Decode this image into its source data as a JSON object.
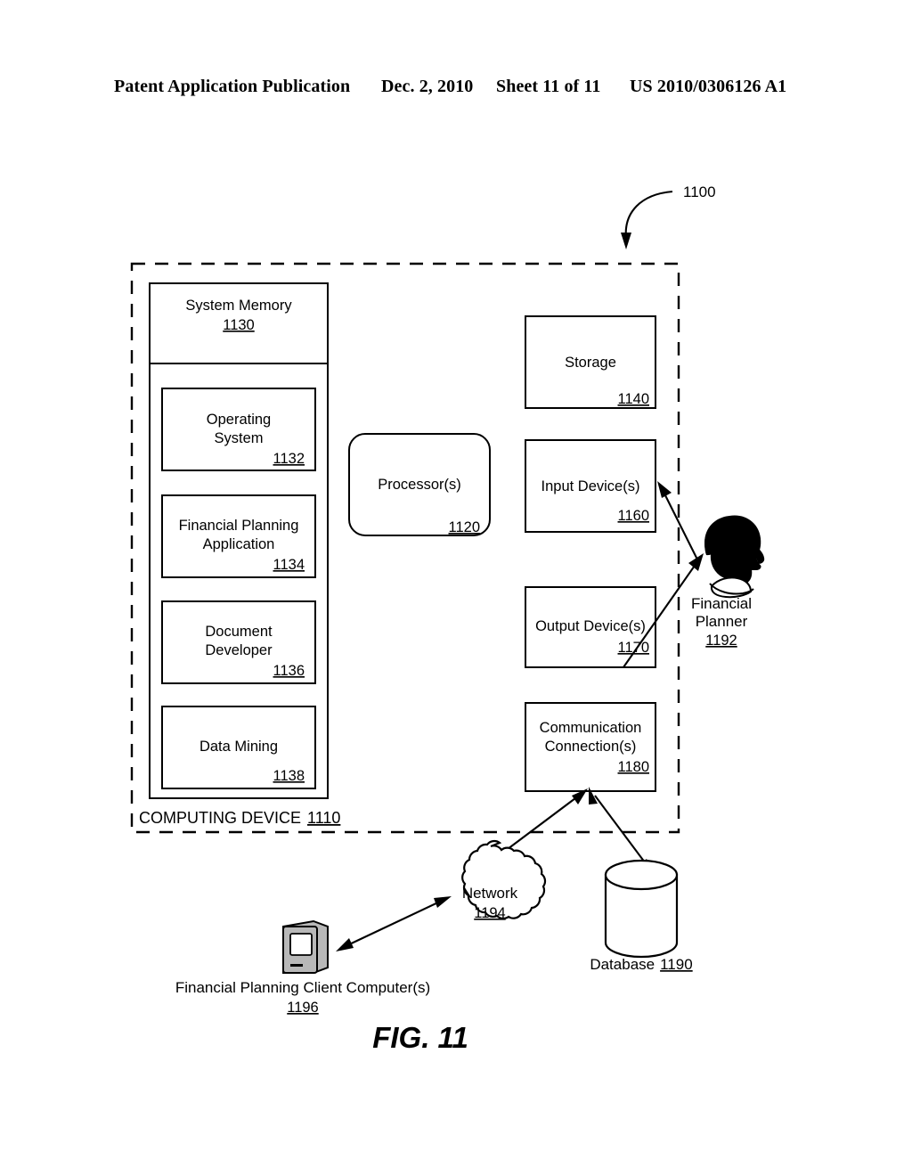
{
  "header": {
    "title": "Patent Application Publication",
    "date": "Dec. 2, 2010",
    "sheet": "Sheet 11 of 11",
    "publication_number": "US 2010/0306126 A1"
  },
  "figure": {
    "label": "FIG. 11",
    "callout": "1100"
  },
  "computing_device": {
    "label": "COMPUTING DEVICE",
    "ref": "1110"
  },
  "blocks": {
    "system_memory": {
      "label": "System Memory",
      "ref": "1130"
    },
    "operating_system": {
      "line1": "Operating",
      "line2": "System",
      "ref": "1132"
    },
    "financial_planning_application": {
      "line1": "Financial Planning",
      "line2": "Application",
      "ref": "1134"
    },
    "document_developer": {
      "line1": "Document",
      "line2": "Developer",
      "ref": "1136"
    },
    "data_mining": {
      "line1": "Data Mining",
      "ref": "1138"
    },
    "processor": {
      "label": "Processor(s)",
      "ref": "1120"
    },
    "storage": {
      "label": "Storage",
      "ref": "1140"
    },
    "input_devices": {
      "label": "Input Device(s)",
      "ref": "1160"
    },
    "output_devices": {
      "label": "Output Device(s)",
      "ref": "1170"
    },
    "communication_connections": {
      "line1": "Communication",
      "line2": "Connection(s)",
      "ref": "1180"
    }
  },
  "externals": {
    "financial_planner": {
      "line1": "Financial",
      "line2": "Planner",
      "ref": "1192"
    },
    "network": {
      "label": "Network",
      "ref": "1194"
    },
    "database": {
      "label": "Database",
      "ref": "1190"
    },
    "client_computer": {
      "label": "Financial Planning Client Computer(s)",
      "ref": "1196"
    }
  },
  "colors": {
    "ink": "#000000",
    "paper": "#ffffff",
    "monitor_gray": "#b8b8b8"
  }
}
